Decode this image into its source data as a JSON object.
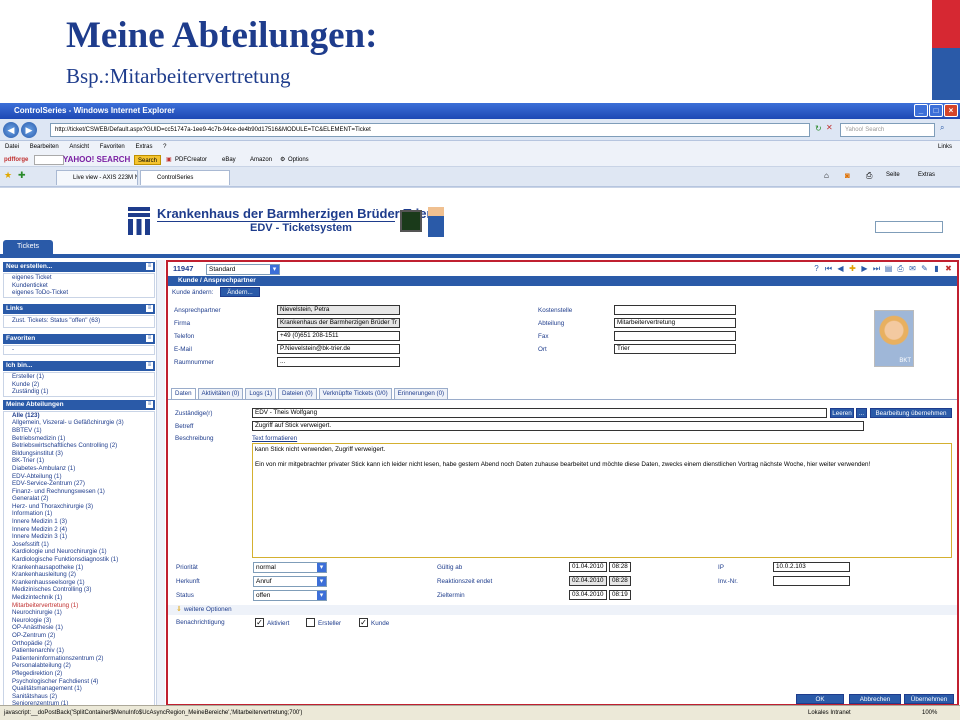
{
  "slide": {
    "title": "Meine Abteilungen:",
    "subtitle": "Bsp.:Mitarbeitervertretung"
  },
  "browser": {
    "window_title": "ControlSeries - Windows Internet Explorer",
    "url": "http://ticket/CSWEB/Default.aspx?GUID=cc51747a-1ee9-4c7b-94ce-de4b90d17516&MODULE=TC&ELEMENT=Ticket",
    "search_placeholder": "Yahoo! Search",
    "menu": [
      "Datei",
      "Bearbeiten",
      "Ansicht",
      "Favoriten",
      "Extras",
      "?"
    ],
    "links_label": "Links",
    "toolbar": [
      "Search",
      "PDFCreator",
      "eBay",
      "Amazon",
      "Options"
    ],
    "tabs": [
      "Live view - AXIS 223M Netwo...",
      "ControlSeries"
    ],
    "right_tools": [
      "Seite",
      "Extras"
    ],
    "status_text": "javascript:__doPostBack('SplitContainer$MenuInfo$UcAsyncRegion_MeineBereiche','Mitarbeitervertretung;700')",
    "zone": "Lokales Intranet",
    "zoom": "100%"
  },
  "header": {
    "hospital": "Krankenhaus der Barmherzigen Brüder Trier",
    "system": "EDV - Ticketsystem",
    "tab": "Tickets"
  },
  "sidebar": {
    "new": {
      "title": "Neu erstellen...",
      "items": [
        "eigenes Ticket",
        "Kundenticket",
        "eigenes ToDo-Ticket"
      ]
    },
    "links": {
      "title": "Links",
      "items": [
        "Zust. Tickets: Status \"offen\" (63)"
      ]
    },
    "favorites": {
      "title": "Favoriten",
      "items": [
        "-"
      ]
    },
    "me": {
      "title": "Ich bin...",
      "items": [
        "Ersteller (1)",
        "Kunde (2)",
        "Zuständig (1)"
      ]
    },
    "departments": {
      "title": "Meine Abteilungen",
      "items": [
        "Alle (123)",
        "Allgemein, Viszeral- u Gefäßchirurgie (3)",
        "BBTEV (1)",
        "Betriebsmedizin (1)",
        "Betriebswirtschaftliches Controlling (2)",
        "Bildungsinstitut (3)",
        "BK-Trier (1)",
        "Diabetes-Ambulanz (1)",
        "EDV-Abteilung (1)",
        "EDV-Service-Zentrum (27)",
        "Finanz- und Rechnungswesen (1)",
        "Generalat (2)",
        "Herz- und Thoraxchirurgie (3)",
        "Information (1)",
        "Innere Medizin 1 (3)",
        "Innere Medizin 2 (4)",
        "Innere Medizin 3 (1)",
        "Josefsstift (1)",
        "Kardiologie und Neurochirurgie (1)",
        "Kardiologische Funktionsdiagnostik (1)",
        "Krankenhausapotheke (1)",
        "Krankenhausleitung (2)",
        "Krankenhausseelsorge (1)",
        "Medizinisches Controlling (3)",
        "Medizintechnik (1)",
        "Mitarbeitervertretung (1)",
        "Neurochirurgie (1)",
        "Neurologie (3)",
        "OP-Anästhesie (1)",
        "OP-Zentrum (2)",
        "Orthopädie (2)",
        "Patientenarchiv (1)",
        "Patienteninformationszentrum (2)",
        "Personalabteilung (2)",
        "Pflegedirektion (2)",
        "Psychologischer Fachdienst (4)",
        "Qualitätsmanagement (1)",
        "Sanitätshaus (2)",
        "Seniorenzentrum (1)",
        "Station 1A (1)",
        "Station 1D1 (1)",
        "Station 1E1 (1)"
      ]
    }
  },
  "ticket": {
    "id": "11947",
    "type": "Standard",
    "section": "Kunde / Ansprechpartner",
    "change_label": "Kunde ändern:",
    "change_btn": "Ändern...",
    "fields": {
      "ansprechpartner": {
        "label": "Ansprechpartner",
        "value": "Nievelstein, Petra"
      },
      "firma": {
        "label": "Firma",
        "value": "Krankenhaus der Barmherzigen Brüder Tr"
      },
      "telefon": {
        "label": "Telefon",
        "value": "+49 (0)651 208-1511"
      },
      "email": {
        "label": "E-Mail",
        "value": "P.Nievelstein@bk-trier.de"
      },
      "raum": {
        "label": "Raumnummer",
        "value": "..."
      },
      "kostenstelle": {
        "label": "Kostenstelle",
        "value": ""
      },
      "abteilung": {
        "label": "Abteilung",
        "value": "Mitarbeitervertretung"
      },
      "fax": {
        "label": "Fax",
        "value": ""
      },
      "ort": {
        "label": "Ort",
        "value": "Trier"
      }
    },
    "photo_badge": "BKT",
    "tabs": [
      "Daten",
      "Aktivitäten (0)",
      "Logs (1)",
      "Dateien (0)",
      "Verknüpfte Tickets (0/0)",
      "Erinnerungen (0)"
    ],
    "zustaendig": {
      "label": "Zuständige(r)",
      "value": "EDV - Theis Wolfgang",
      "btn_clear": "Leeren",
      "btn_more": "...",
      "btn_take": "Bearbeitung übernehmen"
    },
    "betreff": {
      "label": "Betreff",
      "value": "Zugriff auf Stick verweigert."
    },
    "beschreibung": {
      "label": "Beschreibung",
      "format_link": "Text formatieren",
      "line1": "kann Stick nicht verwenden, Zugriff verweigert.",
      "line2": "Ein von mir mitgebrachter privater Stick kann ich leider nicht lesen, habe gestern Abend noch Daten zuhause bearbeitet und möchte diese Daten, zwecks einem dienstlichen Vortrag nächste Woche, hier weiter verwenden!"
    },
    "prioritaet": {
      "label": "Priorität",
      "value": "normal"
    },
    "herkunft": {
      "label": "Herkunft",
      "value": "Anruf"
    },
    "status": {
      "label": "Status",
      "value": "offen"
    },
    "gueltig": {
      "label": "Gültig ab",
      "date": "01.04.2010",
      "time": "08:28"
    },
    "reaktion": {
      "label": "Reaktionszeit endet",
      "date": "02.04.2010",
      "time": "08:28"
    },
    "ziel": {
      "label": "Zieltermin",
      "date": "03.04.2010",
      "time": "08:19"
    },
    "ip": {
      "label": "IP",
      "value": "10.0.2.103"
    },
    "inv": {
      "label": "Inv.-Nr.",
      "value": ""
    },
    "weitere": "weitere Optionen",
    "benachrichtigung": {
      "label": "Benachrichtigung",
      "opt1": "Aktiviert",
      "opt2": "Ersteller",
      "opt3": "Kunde"
    },
    "buttons": {
      "ok": "OK",
      "cancel": "Abbrechen",
      "apply": "Übernehmen"
    }
  }
}
